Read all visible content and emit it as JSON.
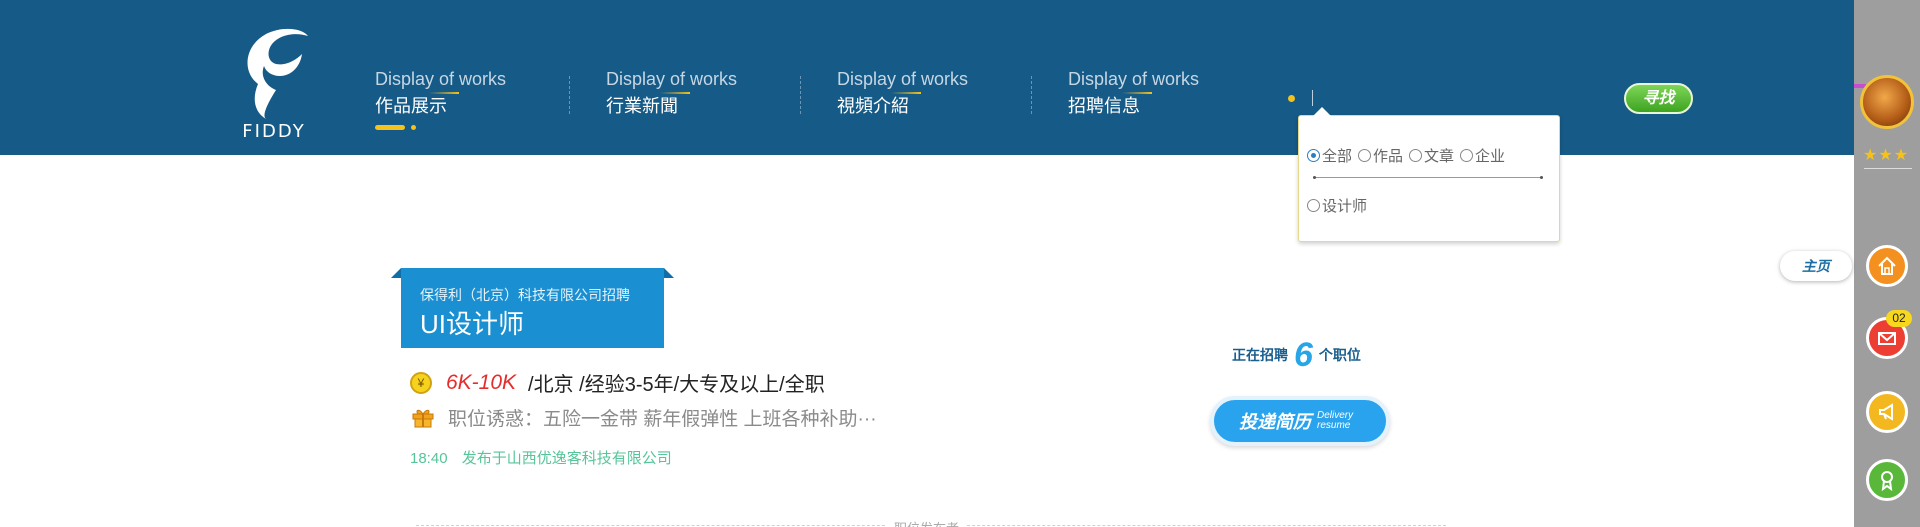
{
  "logo": {
    "word": "FIDDY"
  },
  "nav": [
    {
      "en": "Display of works",
      "zh": "作品展示",
      "active": true
    },
    {
      "en": "Display of works",
      "zh": "行業新聞",
      "active": false
    },
    {
      "en": "Display of works",
      "zh": "視頻介紹",
      "active": false
    },
    {
      "en": "Display of works",
      "zh": "招聘信息",
      "active": false
    }
  ],
  "search": {
    "button_label": "寻找",
    "options": [
      {
        "label": "全部",
        "checked": true
      },
      {
        "label": "作品",
        "checked": false
      },
      {
        "label": "文章",
        "checked": false
      },
      {
        "label": "企业",
        "checked": false
      },
      {
        "label": "设计师",
        "checked": false
      }
    ]
  },
  "job": {
    "company": "保得利（北京）科技有限公司招聘",
    "title": "UI设计师",
    "coin_symbol": "¥",
    "salary": "6K-10K",
    "details": "/北京 /经验3-5年/大专及以上/全职",
    "perks": "职位诱惑：五险一金带 薪年假弹性 上班各种补助···",
    "post_time": "18:40",
    "post_from": "发布于山西优逸客科技有限公司",
    "section_label": "职位发布者"
  },
  "hiring": {
    "prefix": "正在招聘",
    "count": "6",
    "suffix": "个职位"
  },
  "apply": {
    "zh": "投递简历",
    "en_line1": "Delivery",
    "en_line2": "resume"
  },
  "sidebar": {
    "stars": "★★★",
    "home_tip": "主页",
    "mail_badge": "02"
  },
  "colors": {
    "header": "#165a87",
    "accent_yellow": "#f4c21a",
    "ribbon_blue": "#1a8fd1",
    "salary_red": "#e62d2d",
    "post_green": "#57c59a",
    "sidebar_gray": "#9e9e9e"
  }
}
